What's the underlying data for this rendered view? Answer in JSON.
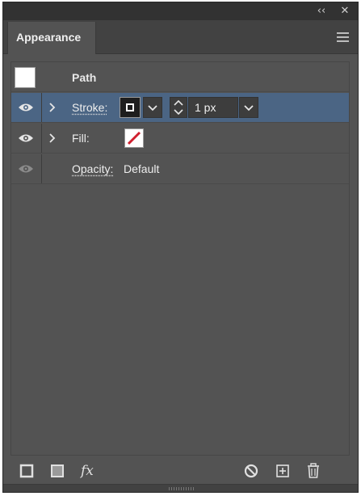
{
  "window": {
    "collapse_glyph": "‹‹",
    "close_glyph": "✕"
  },
  "panel": {
    "tab_label": "Appearance",
    "menu_icon": "hamburger-menu-icon"
  },
  "rows": {
    "path": {
      "label": "Path"
    },
    "stroke": {
      "label": "Stroke:",
      "weight": "1 px",
      "swatch": "black-square-stroke",
      "selected": true
    },
    "fill": {
      "label": "Fill:",
      "swatch": "none-red-slash"
    },
    "opacity": {
      "label": "Opacity:",
      "value": "Default"
    }
  },
  "footer": {
    "icons": [
      "add-new-stroke-icon",
      "add-new-fill-icon",
      "add-new-effect-icon",
      "clear-appearance-icon",
      "duplicate-item-icon",
      "delete-item-icon"
    ],
    "fx_glyph": "fx"
  },
  "colors": {
    "panel_bg": "#535353",
    "selected_row": "#4b6584",
    "none_slash": "#d01f2e"
  }
}
